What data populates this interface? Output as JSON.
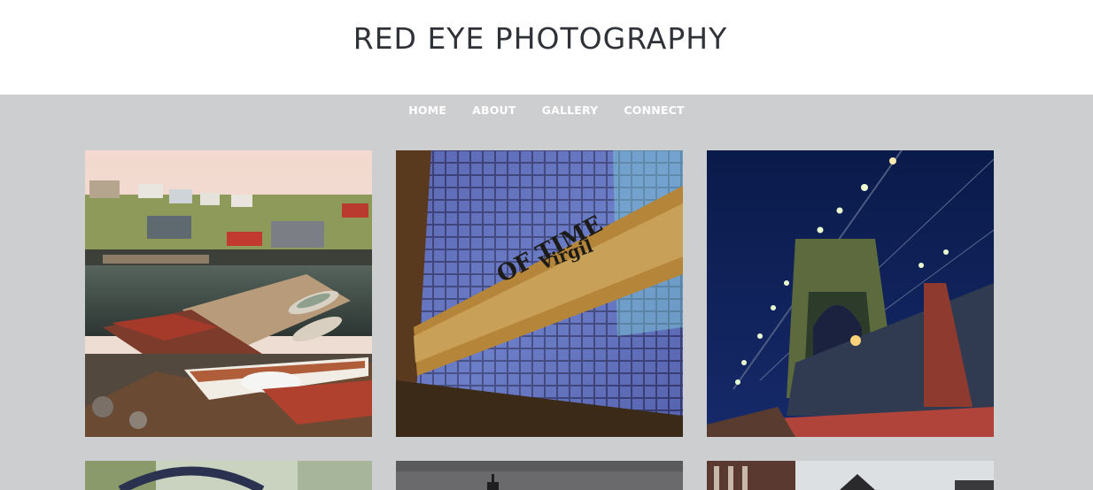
{
  "header": {
    "site_title": "RED EYE PHOTOGRAPHY"
  },
  "nav": {
    "items": [
      {
        "label": "HOME"
      },
      {
        "label": "ABOUT"
      },
      {
        "label": "GALLERY"
      },
      {
        "label": "CONNECT"
      }
    ]
  },
  "gallery": {
    "photos": [
      {
        "subject": "harbor-boats-photo"
      },
      {
        "subject": "memorial-wall-photo"
      },
      {
        "subject": "bridge-night-photo"
      },
      {
        "subject": "ferris-wheel-photo"
      },
      {
        "subject": "cloudy-sky-photo"
      },
      {
        "subject": "buildings-photo"
      }
    ],
    "wall_text": {
      "line1": "OF TIME",
      "line2": "Virgil"
    }
  }
}
